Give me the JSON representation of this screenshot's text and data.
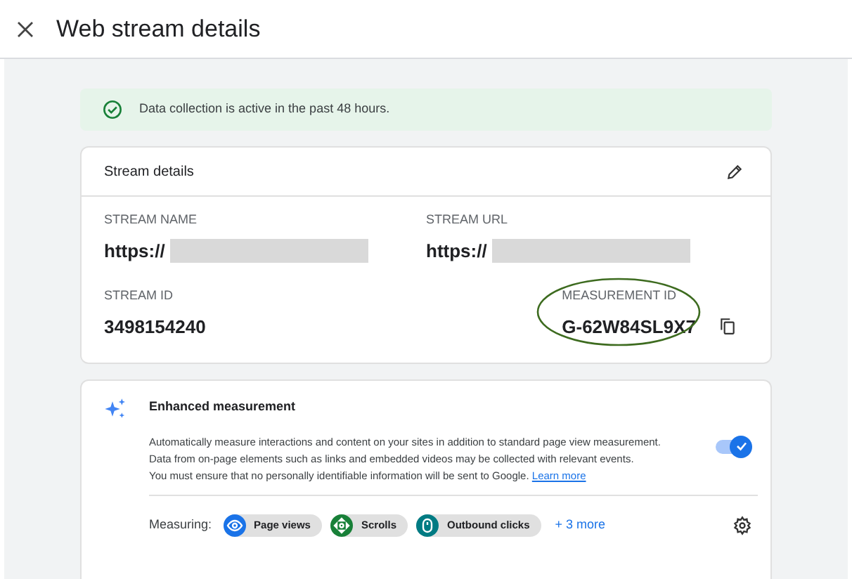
{
  "header": {
    "title": "Web stream details"
  },
  "banner": {
    "text": "Data collection is active in the past 48 hours."
  },
  "stream_details": {
    "title": "Stream details",
    "fields": [
      {
        "label": "STREAM NAME",
        "value": "https://",
        "redacted": true
      },
      {
        "label": "STREAM URL",
        "value": "https://",
        "redacted": true
      },
      {
        "label": "STREAM ID",
        "value": "3498154240",
        "redacted": false
      },
      {
        "label": "MEASUREMENT ID",
        "value": "G-62W84SL9X7",
        "redacted": false,
        "copyable": true,
        "circled": true
      }
    ]
  },
  "enhanced_measurement": {
    "title": "Enhanced measurement",
    "on": true,
    "description": [
      "Automatically measure interactions and content on your sites in addition to standard page view measurement.",
      "Data from on-page elements such as links and embedded videos may be collected with relevant events."
    ],
    "notice": "You must ensure that no personally identifiable information will be sent to Google.",
    "link": "Learn more",
    "measuring_label": "Measuring:",
    "chips": [
      {
        "kind": "eye",
        "label": "Page views",
        "color": "#1a73e8"
      },
      {
        "kind": "scroll",
        "label": "Scrolls",
        "color": "#188038"
      },
      {
        "kind": "mouse",
        "label": "Outbound clicks",
        "color": "#007b83"
      }
    ],
    "more": "+ 3 more"
  }
}
